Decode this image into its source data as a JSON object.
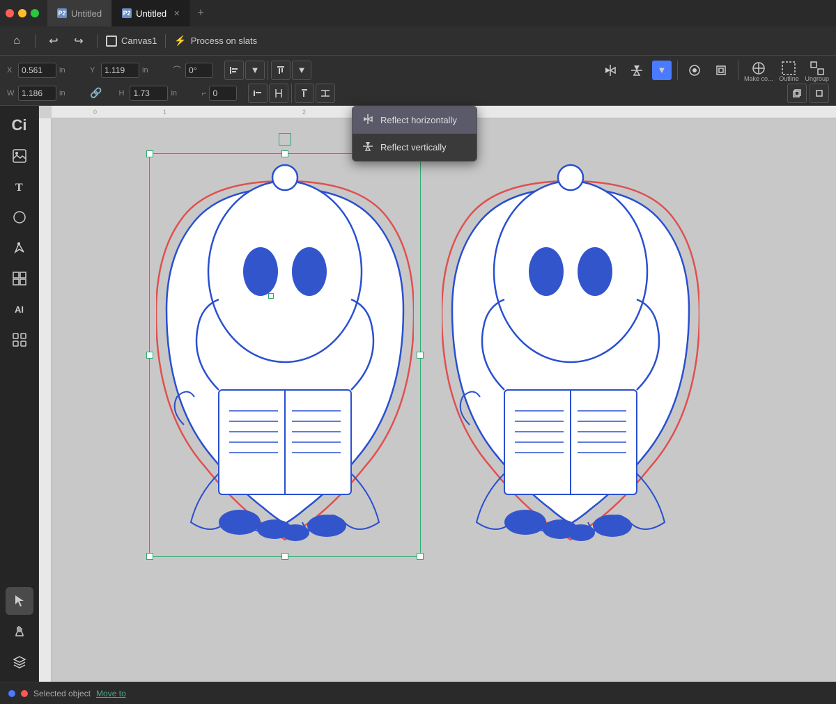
{
  "titlebar": {
    "tabs": [
      {
        "id": "tab1",
        "label": "Untitled",
        "icon": "P2",
        "active": false
      },
      {
        "id": "tab2",
        "label": "Untitled",
        "icon": "P2",
        "active": true
      }
    ],
    "add_tab_label": "+"
  },
  "toolbar": {
    "undo_label": "↩",
    "redo_label": "↪",
    "canvas_label": "Canvas1",
    "process_label": "Process on slats"
  },
  "propbar": {
    "x_label": "X",
    "x_value": "0.561",
    "x_unit": "in",
    "y_label": "Y",
    "y_value": "1.119",
    "y_unit": "in",
    "angle_value": "0°",
    "w_label": "W",
    "w_value": "1.186",
    "w_unit": "in",
    "h_label": "H",
    "h_value": "1.73",
    "h_unit": "in",
    "corner_value": "0",
    "make_component_label": "Make co...",
    "outline_label": "Outline",
    "ungroup_label": "Ungroup"
  },
  "flip_dropdown": {
    "reflect_h_label": "Reflect horizontally",
    "reflect_v_label": "Reflect vertically"
  },
  "statusbar": {
    "status_text": "Selected object",
    "move_to_label": "Move to"
  },
  "sidebar": {
    "tools": [
      {
        "name": "ci-logo",
        "icon": "Ci",
        "active": false
      },
      {
        "name": "image-tool",
        "symbol": "🖼",
        "active": false
      },
      {
        "name": "text-tool",
        "symbol": "T",
        "active": false
      },
      {
        "name": "shape-tool",
        "symbol": "○",
        "active": false
      },
      {
        "name": "pen-tool",
        "symbol": "✏",
        "active": false
      },
      {
        "name": "component-tool",
        "symbol": "⊞",
        "active": false
      },
      {
        "name": "ai-tool",
        "symbol": "AI",
        "active": false
      },
      {
        "name": "apps-tool",
        "symbol": "⊟",
        "active": false
      },
      {
        "name": "select-tool",
        "symbol": "▷",
        "active": true
      },
      {
        "name": "hand-tool",
        "symbol": "✋",
        "active": false
      },
      {
        "name": "layers-tool",
        "symbol": "⊕",
        "active": false
      }
    ]
  }
}
